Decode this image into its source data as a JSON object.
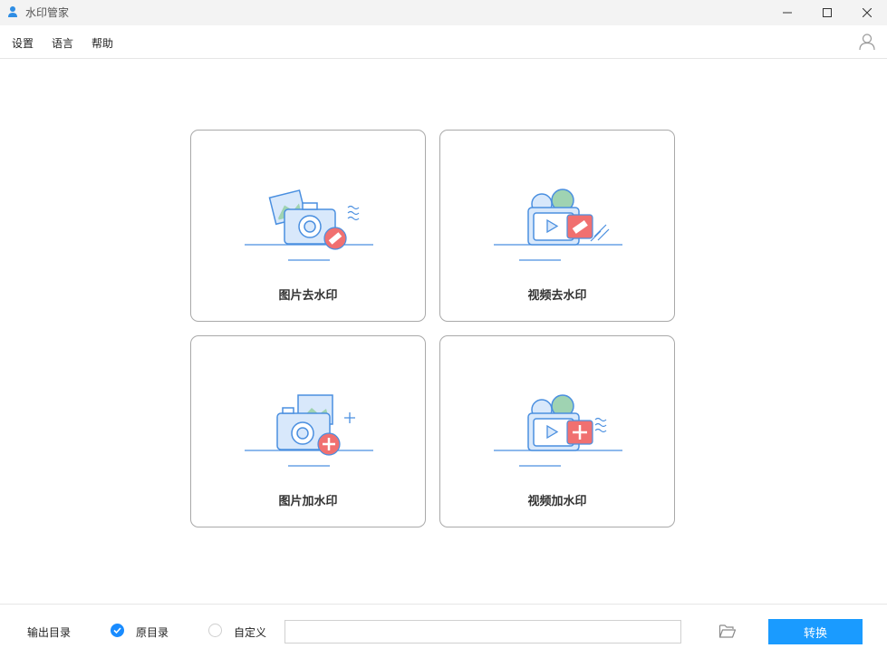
{
  "window": {
    "title": "水印管家"
  },
  "menu": {
    "settings": "设置",
    "language": "语言",
    "help": "帮助"
  },
  "cards": [
    {
      "label": "图片去水印",
      "icon": "photo-remove-watermark-illustration"
    },
    {
      "label": "视频去水印",
      "icon": "video-remove-watermark-illustration"
    },
    {
      "label": "图片加水印",
      "icon": "photo-add-watermark-illustration"
    },
    {
      "label": "视频加水印",
      "icon": "video-add-watermark-illustration"
    }
  ],
  "output": {
    "label": "输出目录",
    "options": [
      {
        "label": "原目录",
        "selected": true
      },
      {
        "label": "自定义",
        "selected": false
      }
    ],
    "path_value": "",
    "convert_label": "转换"
  },
  "colors": {
    "accent": "#1a9bff",
    "illustration_blue": "#4a8fe0",
    "illustration_light": "#d8e8fb",
    "illustration_red": "#f07070",
    "illustration_green": "#9fd3b2"
  }
}
